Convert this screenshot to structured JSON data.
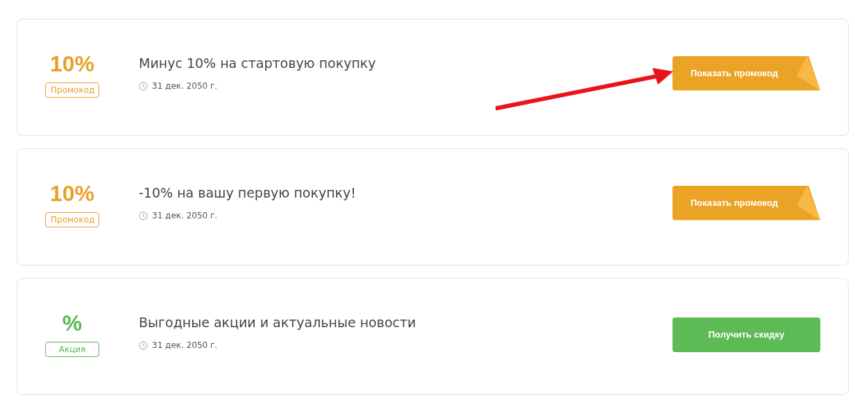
{
  "offers": [
    {
      "kind": "promo",
      "value": "10%",
      "badge": "Промокод",
      "title": "Минус 10% на стартовую покупку",
      "date": "31 дек. 2050 г.",
      "button": "Показать промокод"
    },
    {
      "kind": "promo",
      "value": "10%",
      "badge": "Промокод",
      "title": "-10% на вашу первую покупку!",
      "date": "31 дек. 2050 г.",
      "button": "Показать промокод"
    },
    {
      "kind": "deal",
      "value": "%",
      "badge": "Акция",
      "title": "Выгодные акции и актуальные новости",
      "date": "31 дек. 2050 г.",
      "button": "Получить скидку"
    }
  ]
}
